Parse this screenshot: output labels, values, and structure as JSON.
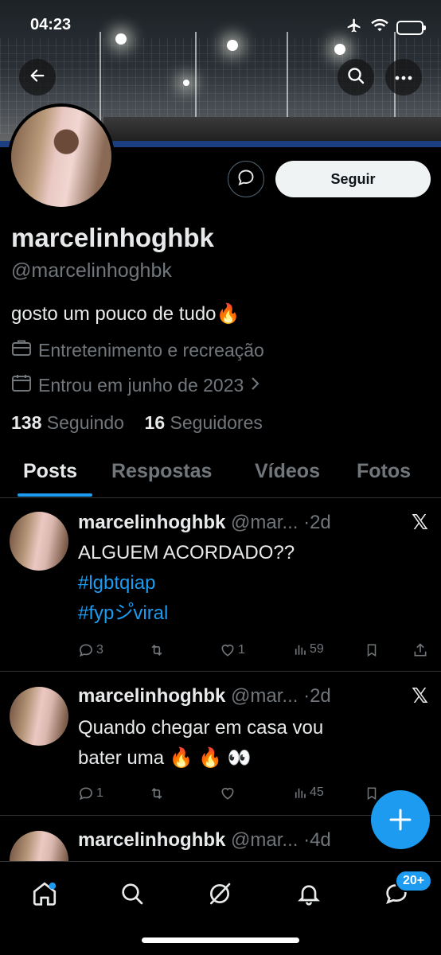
{
  "status_bar": {
    "time": "04:23"
  },
  "profile": {
    "name": "marcelinhoghbk",
    "handle": "@marcelinhoghbk",
    "bio": "gosto um pouco de tudo🔥",
    "category": "Entretenimento e recreação",
    "joined": "Entrou em junho de 2023",
    "following_count": "138",
    "following_label": "Seguindo",
    "followers_count": "16",
    "followers_label": "Seguidores",
    "follow_button": "Seguir"
  },
  "tabs": [
    {
      "label": "Posts",
      "active": true
    },
    {
      "label": "Respostas",
      "active": false
    },
    {
      "label": "Vídeos",
      "active": false
    },
    {
      "label": "Fotos",
      "active": false
    }
  ],
  "posts": [
    {
      "name": "marcelinhoghbk",
      "handle": "@mar...",
      "time": "·2d",
      "text": "ALGUEM ACORDADO??",
      "tags": [
        "#lgbtqiap",
        "#fypシ゚viral"
      ],
      "replies": "3",
      "reposts": "",
      "likes": "1",
      "views": "59"
    },
    {
      "name": "marcelinhoghbk",
      "handle": "@mar...",
      "time": "·2d",
      "text_line1": "Quando chegar em casa vou",
      "text_line2": "bater uma 🔥 🔥 👀",
      "replies": "1",
      "reposts": "",
      "likes": "",
      "views": "45"
    },
    {
      "name": "marcelinhoghbk",
      "handle": "@mar...",
      "time": "·4d"
    }
  ],
  "bottom_nav": {
    "messages_badge": "20+"
  },
  "colors": {
    "accent": "#1d9bf0",
    "background": "#000000",
    "muted": "#71767b"
  }
}
